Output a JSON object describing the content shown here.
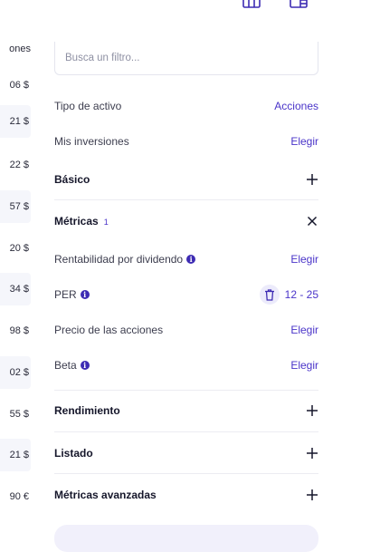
{
  "left_column": {
    "header": "ones",
    "values": [
      "06 $",
      "21 $",
      "22 $",
      "57 $",
      "20 $",
      "34 $",
      "98 $",
      "02 $",
      "55 $",
      "21 $",
      "90 €"
    ]
  },
  "toolbar": {
    "icons": [
      "columns-icon",
      "panel-icon"
    ]
  },
  "search": {
    "placeholder": "Busca un filtro..."
  },
  "filters": {
    "asset_type": {
      "label": "Tipo de activo",
      "value": "Acciones"
    },
    "my_investments": {
      "label": "Mis inversiones",
      "action": "Elegir"
    }
  },
  "sections": {
    "basic": {
      "label": "Básico"
    },
    "metrics": {
      "label": "Métricas",
      "count": "1",
      "items": [
        {
          "label": "Rentabilidad por dividendo",
          "info": true,
          "action": "Elegir"
        },
        {
          "label": "PER",
          "info": true,
          "range": "12 - 25"
        },
        {
          "label": "Precio de las acciones",
          "info": false,
          "action": "Elegir"
        },
        {
          "label": "Beta",
          "info": true,
          "action": "Elegir"
        }
      ]
    },
    "performance": {
      "label": "Rendimiento"
    },
    "listing": {
      "label": "Listado"
    },
    "advanced_metrics": {
      "label": "Métricas avanzadas"
    }
  },
  "colors": {
    "accent": "#4a34c9",
    "icon_dark": "#3d2bb3",
    "divider": "#ececf2"
  }
}
